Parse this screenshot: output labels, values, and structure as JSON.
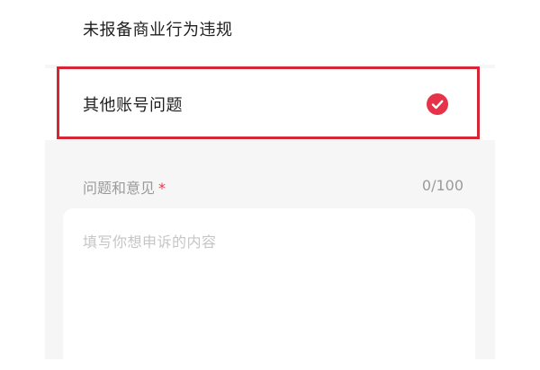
{
  "options": [
    {
      "label": "未报备商业行为违规",
      "selected": false
    },
    {
      "label": "其他账号问题",
      "selected": true
    }
  ],
  "feedback": {
    "label": "问题和意见",
    "required_mark": "*",
    "counter": "0/100",
    "placeholder": "填写你想申诉的内容"
  },
  "colors": {
    "accent": "#e5334a",
    "highlight_border": "#d42635",
    "panel_background": "#f6f6f7"
  },
  "icons": {
    "selected_option": "check-circle-icon"
  }
}
